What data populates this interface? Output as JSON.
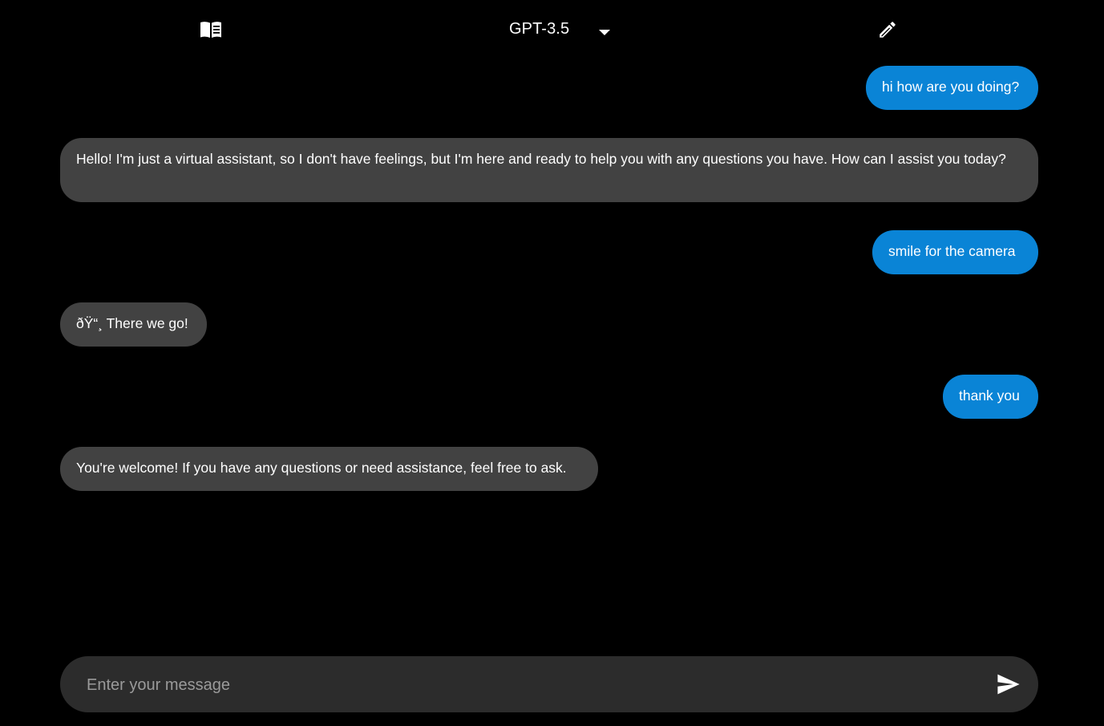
{
  "header": {
    "docs_icon": "book-icon",
    "model": {
      "selected": "GPT-3.5",
      "caret_icon": "caret-down-icon"
    },
    "new_chat_icon": "pencil-icon"
  },
  "messages": [
    {
      "role": "user",
      "text": "hi how are you doing?"
    },
    {
      "role": "assistant",
      "text": "Hello! I'm just a virtual assistant, so I don't have feelings, but I'm here and ready to help you with any questions you have. How can I assist you today?"
    },
    {
      "role": "user",
      "text": "smile for the camera"
    },
    {
      "role": "assistant",
      "text": "ðŸ“¸ There we go!"
    },
    {
      "role": "user",
      "text": "thank you"
    },
    {
      "role": "assistant",
      "text": "You're welcome! If you have any questions or need assistance, feel free to ask."
    }
  ],
  "composer": {
    "placeholder": "Enter your message",
    "value": "",
    "send_icon": "send-icon"
  },
  "colors": {
    "background": "#000000",
    "user_bubble": "#0a84d6",
    "assistant_bubble": "#424242",
    "composer": "#2c2c2c",
    "placeholder": "#9a9a9a"
  }
}
